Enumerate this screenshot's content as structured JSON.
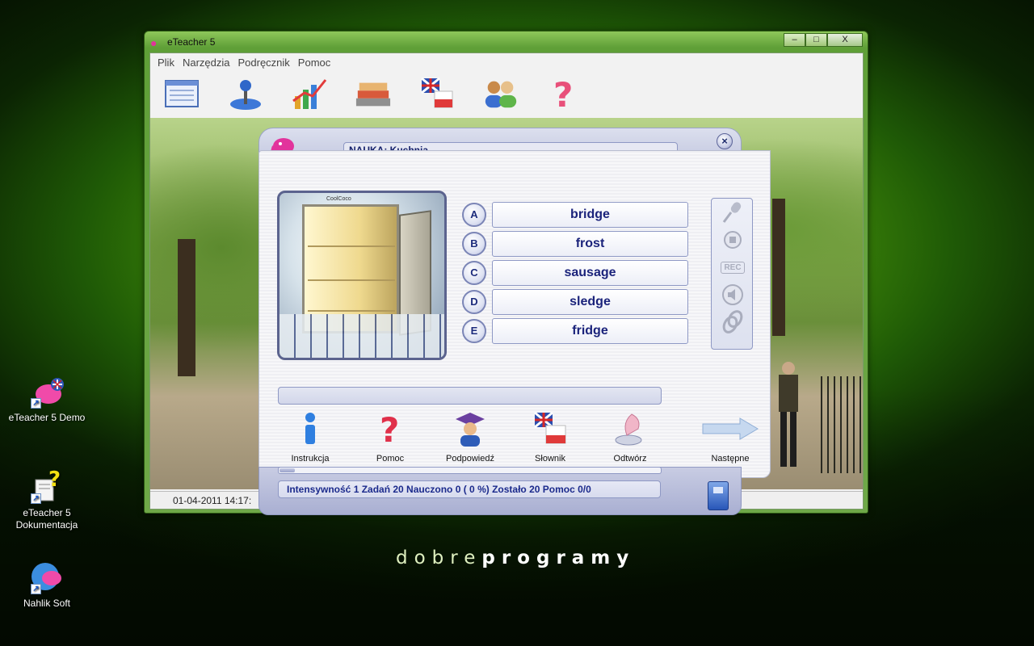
{
  "desktop": {
    "brand_light": "dobre",
    "brand_bold": "programy",
    "icons": [
      {
        "label": "eTeacher 5 Demo",
        "icon": "pink-elephant-icon"
      },
      {
        "label": "eTeacher 5 Dokumentacja",
        "icon": "help-document-icon"
      },
      {
        "label": "Nahlik Soft",
        "icon": "globe-elephant-icon"
      }
    ]
  },
  "window": {
    "title": "eTeacher 5",
    "controls": {
      "minimize": "–",
      "maximize": "□",
      "close": "X"
    },
    "menu": [
      "Plik",
      "Narzędzia",
      "Podręcznik",
      "Pomoc"
    ],
    "toolbar_icons": [
      "list-window-icon",
      "joystick-icon",
      "chart-icon",
      "books-icon",
      "dictionary-flag-icon",
      "users-icon",
      "help-question-icon"
    ],
    "status_datetime": "01-04-2011 14:17:"
  },
  "dialog": {
    "title": "NAUKA: Kuchnia",
    "close_symbol": "×",
    "picture_brand": "CoolCoco",
    "answers": [
      {
        "letter": "A",
        "text": "bridge"
      },
      {
        "letter": "B",
        "text": "frost"
      },
      {
        "letter": "C",
        "text": "sausage"
      },
      {
        "letter": "D",
        "text": "sledge"
      },
      {
        "letter": "E",
        "text": "fridge"
      }
    ],
    "side_controls": [
      "microphone-icon",
      "stop-icon",
      "REC",
      "speaker-icon",
      "link-icon"
    ],
    "hint_text": "",
    "actions": [
      {
        "label": "Instrukcja",
        "icon": "info-icon"
      },
      {
        "label": "Pomoc",
        "icon": "question-icon"
      },
      {
        "label": "Podpowiedź",
        "icon": "graduate-icon"
      },
      {
        "label": "Słownik",
        "icon": "dictionary-flag-icon"
      },
      {
        "label": "Odtwórz",
        "icon": "gramophone-icon"
      },
      {
        "label": "Następne",
        "icon": "arrow-right-icon"
      }
    ],
    "progress_fraction": 0.04,
    "info": "Intensywność 1 Zadań 20 Nauczono 0 ( 0 %) Zostało 20 Pomoc 0/0"
  },
  "colors": {
    "accent_blue": "#1b237b",
    "brand_pink": "#e2339c",
    "wallpaper_green": "#4fa00a"
  }
}
